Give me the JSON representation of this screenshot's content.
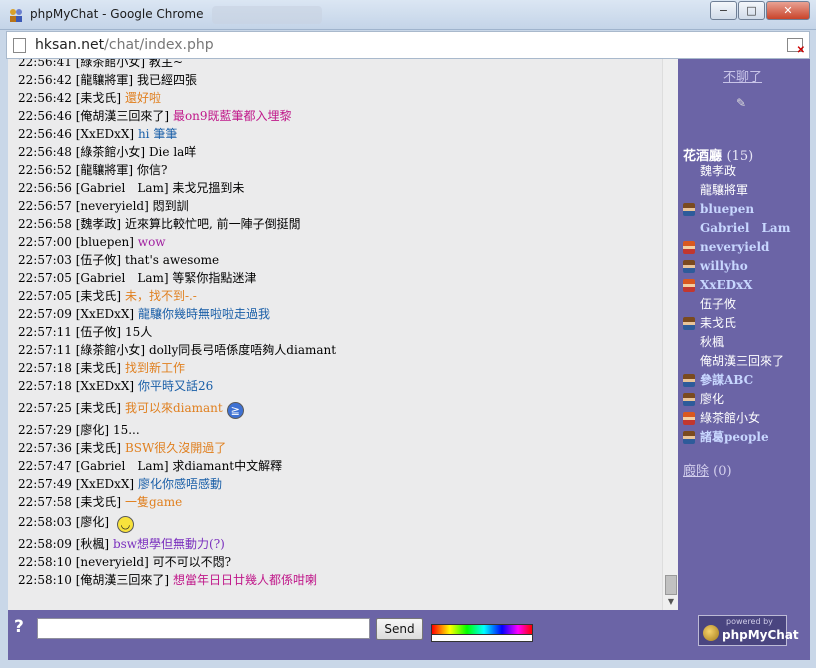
{
  "window": {
    "title": "phpMyChat - Google Chrome",
    "url_host": "hksan.net",
    "url_path": "/chat/index.php",
    "buttons": {
      "minimize": "−",
      "maximize": "□",
      "close": "✕"
    }
  },
  "messages": [
    {
      "time": "22:56:41",
      "user": "[綠茶館小女]",
      "text": "教主~",
      "color": "#000000"
    },
    {
      "time": "22:56:42",
      "user": "[龍驤將軍]",
      "text": "我已經四張",
      "color": "#000000"
    },
    {
      "time": "22:56:42",
      "user": "[耒戈氏]",
      "text": "還好啦",
      "color": "#e08020"
    },
    {
      "time": "22:56:46",
      "user": "[俺胡漢三回來了]",
      "text": "最on9既藍筆都入埋黎",
      "color": "#c0188a"
    },
    {
      "time": "22:56:46",
      "user": "[XxEDxX]",
      "text": "hi 筆筆",
      "color": "#1a5fa8"
    },
    {
      "time": "22:56:48",
      "user": "[綠茶館小女]",
      "text": "Die la咩",
      "color": "#000000"
    },
    {
      "time": "22:56:52",
      "user": "[龍驤將軍]",
      "text": "你信?",
      "color": "#000000"
    },
    {
      "time": "22:56:56",
      "user": "[Gabriel　Lam]",
      "text": "耒戈兄搵到未",
      "color": "#000000"
    },
    {
      "time": "22:56:57",
      "user": "[neveryield]",
      "text": "悶到訓",
      "color": "#000000"
    },
    {
      "time": "22:56:58",
      "user": "[魏孝政]",
      "text": "近來算比較忙吧, 前一陣子倒挺閒",
      "color": "#000000"
    },
    {
      "time": "22:57:00",
      "user": "[bluepen]",
      "text": "wow",
      "color": "#a020a0"
    },
    {
      "time": "22:57:03",
      "user": "[伍子攸]",
      "text": "that's awesome",
      "color": "#000000"
    },
    {
      "time": "22:57:05",
      "user": "[Gabriel　Lam]",
      "text": "等緊你指點迷津",
      "color": "#000000"
    },
    {
      "time": "22:57:05",
      "user": "[耒戈氏]",
      "text": "未，找不到-.-",
      "color": "#e08020"
    },
    {
      "time": "22:57:09",
      "user": "[XxEDxX]",
      "text": "龍驤你幾時無啦啦走過我",
      "color": "#1a5fa8"
    },
    {
      "time": "22:57:11",
      "user": "[伍子攸]",
      "text": "15人",
      "color": "#000000"
    },
    {
      "time": "22:57:11",
      "user": "[綠茶館小女]",
      "text": "dolly同長弓唔係度唔夠人diamant",
      "color": "#000000"
    },
    {
      "time": "22:57:18",
      "user": "[耒戈氏]",
      "text": "找到新工作",
      "color": "#e08020"
    },
    {
      "time": "22:57:18",
      "user": "[XxEDxX]",
      "text": "你平時又話26",
      "color": "#1a5fa8"
    },
    {
      "time": "22:57:25",
      "user": "[耒戈氏]",
      "text": "我可以來diamant",
      "color": "#e08020",
      "smiley": "blue"
    },
    {
      "time": "22:57:29",
      "user": "[廖化]",
      "text": "15...",
      "color": "#000000"
    },
    {
      "time": "22:57:36",
      "user": "[耒戈氏]",
      "text": "BSW很久沒開過了",
      "color": "#e08020"
    },
    {
      "time": "22:57:47",
      "user": "[Gabriel　Lam]",
      "text": "求diamant中文解釋",
      "color": "#000000"
    },
    {
      "time": "22:57:49",
      "user": "[XxEDxX]",
      "text": "廖化你感唔感動",
      "color": "#1a5fa8"
    },
    {
      "time": "22:57:58",
      "user": "[耒戈氏]",
      "text": "一隻game",
      "color": "#e08020"
    },
    {
      "time": "22:58:03",
      "user": "[廖化]",
      "text": "",
      "color": "#000000",
      "smiley": "yellow"
    },
    {
      "time": "22:58:09",
      "user": "[秋楓]",
      "text": "bsw想學但無動力(?)",
      "color": "#7a2fbe"
    },
    {
      "time": "22:58:10",
      "user": "[neveryield]",
      "text": "可不可以不悶?",
      "color": "#000000"
    },
    {
      "time": "22:58:10",
      "user": "[俺胡漢三回來了]",
      "text": "想當年日日廿幾人都係咁喇",
      "color": "#c0188a"
    }
  ],
  "sidebar": {
    "leave_label": "不聊了",
    "room_name": "花酒廳",
    "room_count": "(15)",
    "users": [
      {
        "name": "魏孝政",
        "avatar": "",
        "mod": false
      },
      {
        "name": "龍驤將軍",
        "avatar": "",
        "mod": false
      },
      {
        "name": "bluepen",
        "avatar": "m",
        "mod": true
      },
      {
        "name": "Gabriel　Lam",
        "avatar": "",
        "mod": true
      },
      {
        "name": "neveryield",
        "avatar": "f",
        "mod": true
      },
      {
        "name": "willyho",
        "avatar": "m",
        "mod": true
      },
      {
        "name": "XxEDxX",
        "avatar": "f",
        "mod": true
      },
      {
        "name": "伍子攸",
        "avatar": "",
        "mod": false
      },
      {
        "name": "耒戈氏",
        "avatar": "m",
        "mod": false
      },
      {
        "name": "秋楓",
        "avatar": "",
        "mod": false
      },
      {
        "name": "俺胡漢三回來了",
        "avatar": "",
        "mod": false
      },
      {
        "name": "參謀ABC",
        "avatar": "m",
        "mod": true
      },
      {
        "name": "廖化",
        "avatar": "m",
        "mod": false
      },
      {
        "name": "綠茶館小女",
        "avatar": "f",
        "mod": false
      },
      {
        "name": "諸葛people",
        "avatar": "m",
        "mod": true
      }
    ],
    "other_room": "廏除",
    "other_room_count": "(0)"
  },
  "bottom": {
    "help_label": "?",
    "input_value": "",
    "send_label": "Send",
    "logo_small": "powered by",
    "logo_big": "phpMyChat"
  }
}
